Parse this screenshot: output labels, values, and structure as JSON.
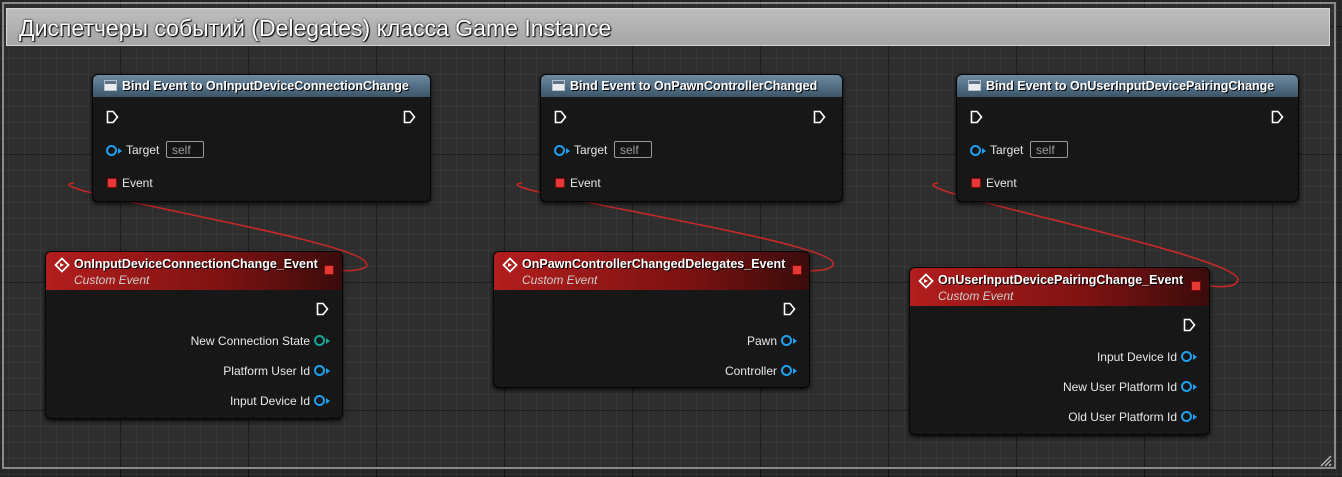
{
  "comment": {
    "title": "Диспетчеры событий (Delegates) класса Game Instance"
  },
  "bind_nodes": [
    {
      "title": "Bind Event to OnInputDeviceConnectionChange",
      "target_label": "Target",
      "target_value": "self",
      "event_label": "Event"
    },
    {
      "title": "Bind Event to OnPawnControllerChanged",
      "target_label": "Target",
      "target_value": "self",
      "event_label": "Event"
    },
    {
      "title": "Bind Event to OnUserInputDevicePairingChange",
      "target_label": "Target",
      "target_value": "self",
      "event_label": "Event"
    }
  ],
  "event_nodes": [
    {
      "title": "OnInputDeviceConnectionChange_Event",
      "subtitle": "Custom Event",
      "outputs": [
        "New Connection State",
        "Platform User Id",
        "Input Device Id"
      ]
    },
    {
      "title": "OnPawnControllerChangedDelegates_Event",
      "subtitle": "Custom Event",
      "outputs": [
        "Pawn",
        "Controller"
      ]
    },
    {
      "title": "OnUserInputDevicePairingChange_Event",
      "subtitle": "Custom Event",
      "outputs": [
        "Input Device Id",
        "New User Platform Id",
        "Old User Platform Id"
      ]
    }
  ],
  "colors": {
    "delegate_wire": "#c62828",
    "object_pin": "#1ea0f0",
    "enum_pin": "#1aa59a",
    "event_header": "#b31d1d",
    "function_header": "#3d5568"
  }
}
